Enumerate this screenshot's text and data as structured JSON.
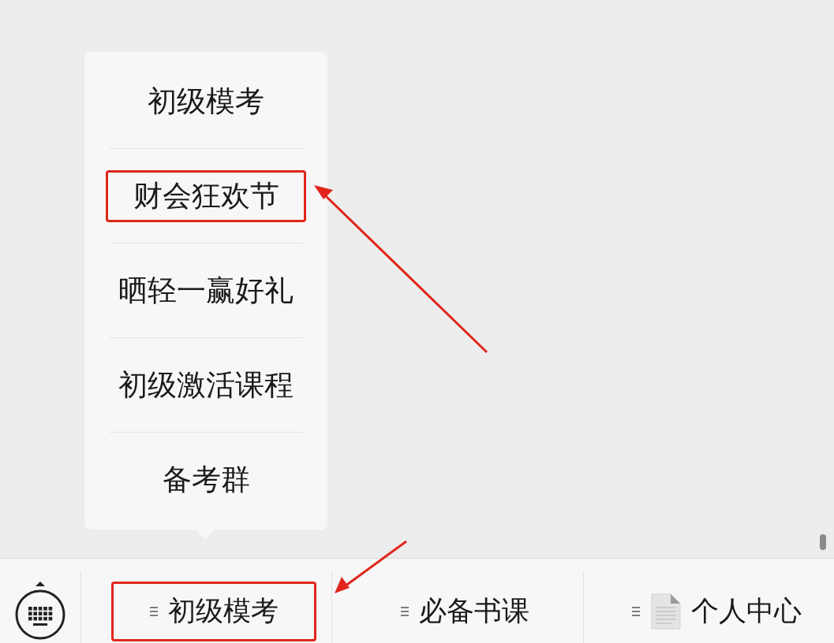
{
  "popup_menu": {
    "items": [
      {
        "label": "初级模考",
        "highlighted": false
      },
      {
        "label": "财会狂欢节",
        "highlighted": true
      },
      {
        "label": "晒轻一赢好礼",
        "highlighted": false
      },
      {
        "label": "初级激活课程",
        "highlighted": false
      },
      {
        "label": "备考群",
        "highlighted": false
      }
    ]
  },
  "menu_bar": {
    "tabs": [
      {
        "label": "初级模考",
        "kind": "text",
        "highlighted": true
      },
      {
        "label": "必备书课",
        "kind": "text",
        "highlighted": false
      },
      {
        "label": "个人中心",
        "kind": "document",
        "highlighted": false
      }
    ]
  }
}
